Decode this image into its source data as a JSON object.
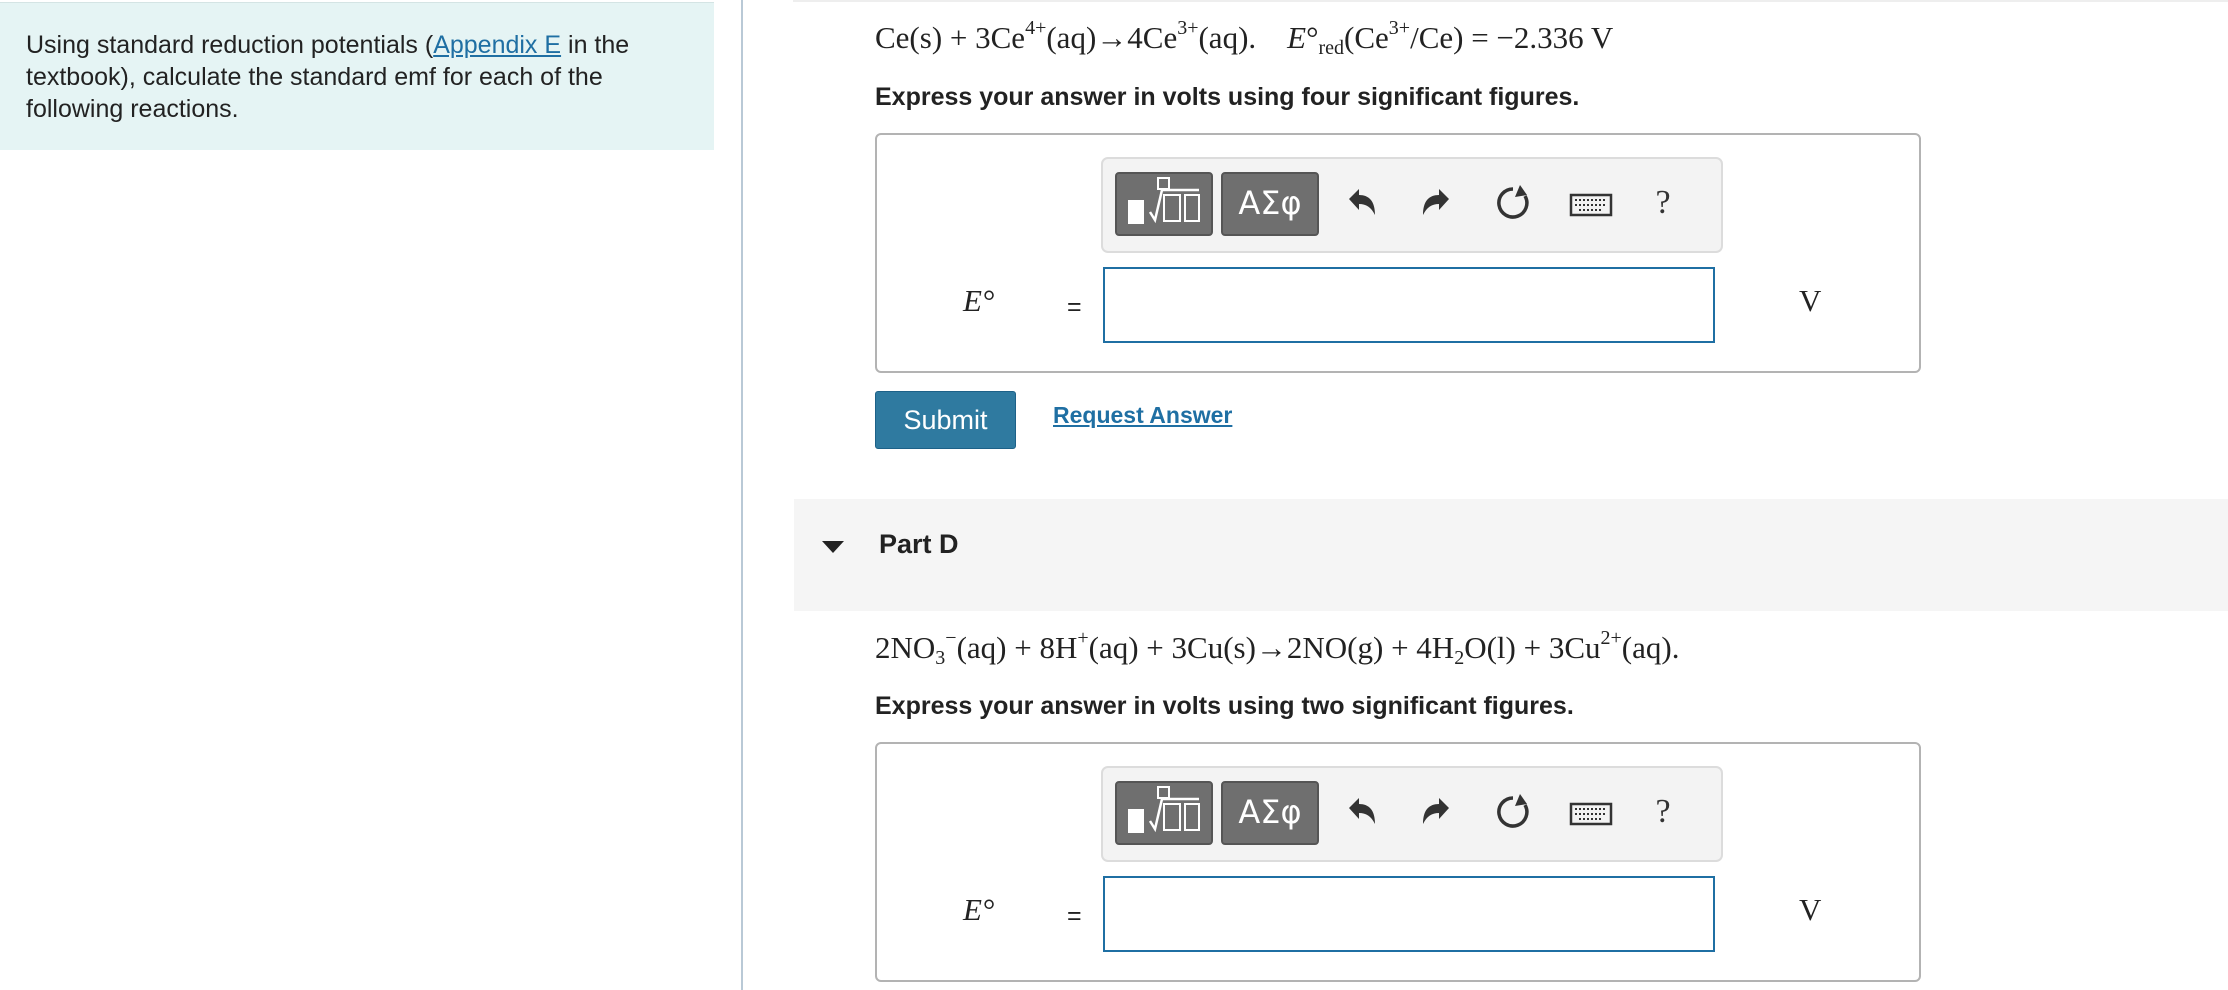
{
  "intro": {
    "text_before": "Using standard reduction potentials (",
    "link": "Appendix E",
    "text_after": " in the textbook), calculate the standard emf for each of the following reactions."
  },
  "part_c": {
    "instruction": "Express your answer  in volts using four significant figures.",
    "answer_label": "E°",
    "equals": "=",
    "input_value": "",
    "unit": "V",
    "submit_label": "Submit",
    "request_label": "Request Answer"
  },
  "part_d": {
    "title": "Part D",
    "instruction": "Express your answer  in volts using two significant figures.",
    "answer_label": "E°",
    "equals": "=",
    "input_value": "",
    "unit": "V"
  },
  "toolbar": {
    "symbols_label": "ΑΣφ",
    "help_label": "?",
    "icons": [
      "templates-icon",
      "symbols-icon",
      "undo-icon",
      "redo-icon",
      "reset-icon",
      "keyboard-icon",
      "help-icon"
    ]
  },
  "colors": {
    "accent": "#2f7aa0",
    "link": "#1f6fa3",
    "intro_bg": "#e5f4f4"
  }
}
